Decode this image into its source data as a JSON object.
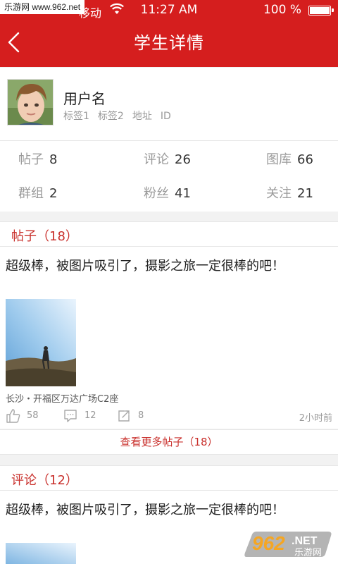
{
  "watermark_top": "乐游网 www.962.net",
  "status_bar": {
    "carrier": "移动",
    "time": "11:27 AM",
    "battery": "100 %"
  },
  "header": {
    "title": "学生详情"
  },
  "profile": {
    "username": "用户名",
    "tags": [
      "标签1",
      "标签2",
      "地址",
      "ID"
    ],
    "stats": [
      {
        "label": "帖子",
        "value": "8"
      },
      {
        "label": "评论",
        "value": "26"
      },
      {
        "label": "图库",
        "value": "66"
      },
      {
        "label": "群组",
        "value": "2"
      },
      {
        "label": "粉丝",
        "value": "41"
      },
      {
        "label": "关注",
        "value": "21"
      }
    ]
  },
  "posts_section": {
    "title": "帖子（18）",
    "post": {
      "text": "超级棒，被图片吸引了，摄影之旅一定很棒的吧！",
      "location": "长沙・开福区万达广场C2座",
      "likes": "58",
      "comments": "12",
      "shares": "8",
      "time": "2小时前"
    },
    "more_label": "查看更多帖子（18）"
  },
  "comments_section": {
    "title": "评论（12）",
    "post": {
      "text": "超级棒，被图片吸引了，摄影之旅一定很棒的吧！"
    }
  },
  "watermark_bottom": {
    "number": "962",
    "suffix": ".NET",
    "name": "乐游网"
  },
  "colors": {
    "brand_red": "#d51e1e",
    "accent_red": "#c9302c"
  },
  "icons": [
    "chevron-left-icon",
    "wifi-icon",
    "battery-icon",
    "thumbs-up-icon",
    "comment-icon",
    "share-edit-icon"
  ]
}
